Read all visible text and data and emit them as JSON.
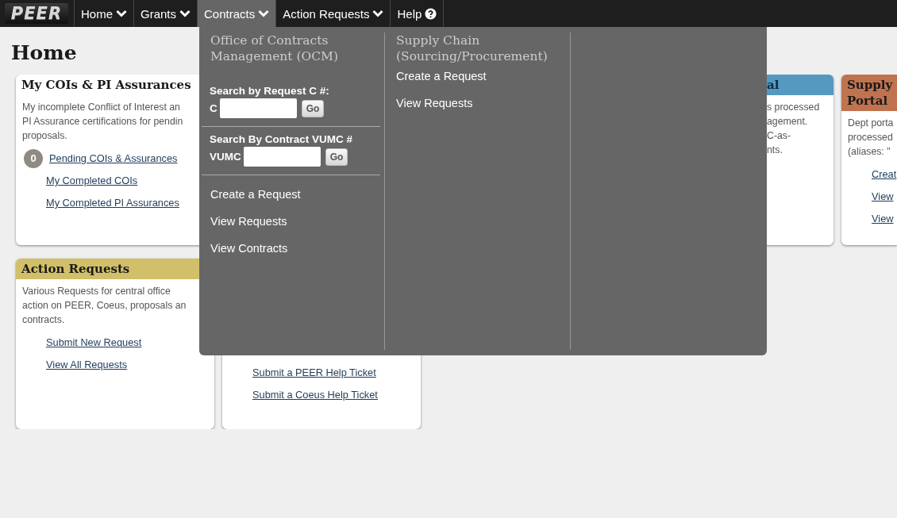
{
  "logo": "PEER",
  "nav": [
    {
      "label": "Home",
      "kind": "menu",
      "selected": false
    },
    {
      "label": "Grants",
      "kind": "menu",
      "selected": false
    },
    {
      "label": "Contracts",
      "kind": "menu",
      "selected": true
    },
    {
      "label": "Action Requests",
      "kind": "menu",
      "selected": false
    },
    {
      "label": "Help",
      "kind": "help",
      "selected": false
    }
  ],
  "page_title": "Home",
  "rows": [
    [
      {
        "kind": "full",
        "title": [
          "My COIs & PI Assurances"
        ],
        "description": [
          "My incomplete Conflict of Interest an",
          "PI Assurance certifications for pendin",
          "proposals."
        ],
        "links": [
          {
            "label": "Pending COIs & Assurances",
            "badge": "0"
          },
          {
            "label": "My Completed COIs"
          },
          {
            "label": "My Completed PI Assurances"
          }
        ]
      },
      {
        "kind": "covered-left",
        "color": "#5599c0",
        "title": [
          "al"
        ],
        "description": [
          "s processed",
          "agement.",
          "C-as-",
          "nts."
        ]
      },
      {
        "kind": "edge",
        "color": "#c0734f",
        "title": [
          "Supply",
          "Portal"
        ],
        "description": [
          "Dept porta",
          "processed",
          "(aliases: \""
        ],
        "links": [
          {
            "label": "Creat"
          },
          {
            "label": "View"
          },
          {
            "label": "View"
          }
        ]
      }
    ],
    [
      {
        "kind": "full",
        "color": "#d1bf6a",
        "title": [
          "Action Requests"
        ],
        "description": [
          "Various Requests for central office",
          "action on PEER, Coeus, proposals an",
          "contracts."
        ],
        "links": [
          {
            "label": "Submit New Request"
          },
          {
            "label": "View All Requests"
          }
        ]
      },
      {
        "kind": "covered-top",
        "links": [
          {
            "label": "Submit a PEER Help Ticket"
          },
          {
            "label": "Submit a Coeus Help Ticket"
          }
        ]
      }
    ]
  ],
  "dropdown": {
    "columns": [
      {
        "heading": "Office of Contracts Management (OCM)",
        "searches": [
          {
            "label": "Search by Request C #:",
            "prefix": "C",
            "button": "Go"
          },
          {
            "label": "Search By Contract VUMC #",
            "prefix": "VUMC",
            "button": "Go"
          }
        ],
        "links": [
          "Create a Request",
          "View Requests",
          "View Contracts"
        ]
      },
      {
        "heading": "Supply Chain (Sourcing/Procurement)",
        "links": [
          "Create a Request",
          "View Requests"
        ]
      }
    ]
  }
}
